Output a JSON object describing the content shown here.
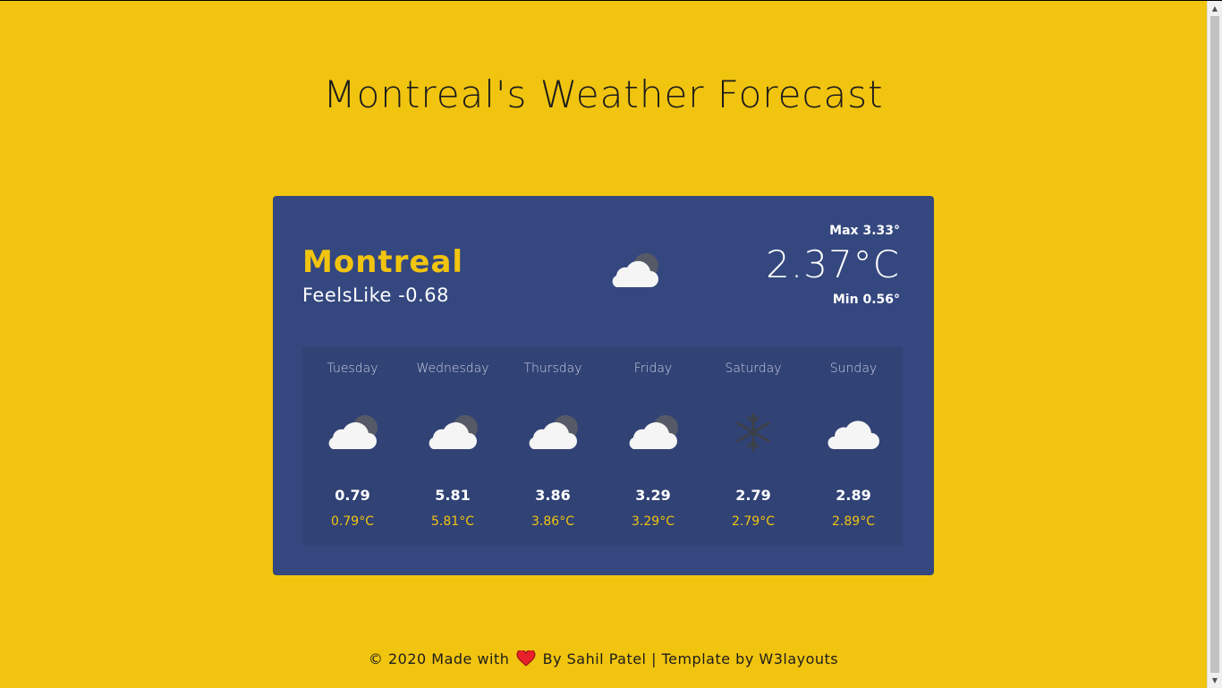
{
  "page": {
    "title": "Montreal's Weather Forecast"
  },
  "current": {
    "city": "Montreal",
    "feels_like": "FeelsLike -0.68",
    "max": "Max 3.33°",
    "temp": "2.37°C",
    "min": "Min 0.56°",
    "icon": "partly-cloudy-night-icon"
  },
  "forecast": [
    {
      "day": "Tuesday",
      "value": "0.79",
      "temp": "0.79°C",
      "icon": "partly-cloudy-night-icon"
    },
    {
      "day": "Wednesday",
      "value": "5.81",
      "temp": "5.81°C",
      "icon": "partly-cloudy-night-icon"
    },
    {
      "day": "Thursday",
      "value": "3.86",
      "temp": "3.86°C",
      "icon": "partly-cloudy-night-icon"
    },
    {
      "day": "Friday",
      "value": "3.29",
      "temp": "3.29°C",
      "icon": "partly-cloudy-night-icon"
    },
    {
      "day": "Saturday",
      "value": "2.79",
      "temp": "2.79°C",
      "icon": "snowflake-icon"
    },
    {
      "day": "Sunday",
      "value": "2.89",
      "temp": "2.89°C",
      "icon": "cloud-icon"
    }
  ],
  "footer": {
    "before": "© 2020 Made with",
    "after": "By Sahil Patel | Template by W3layouts",
    "icon": "heart-icon"
  },
  "colors": {
    "background": "#f1c40f",
    "card": "#34477f",
    "accent": "#f1c40f"
  }
}
